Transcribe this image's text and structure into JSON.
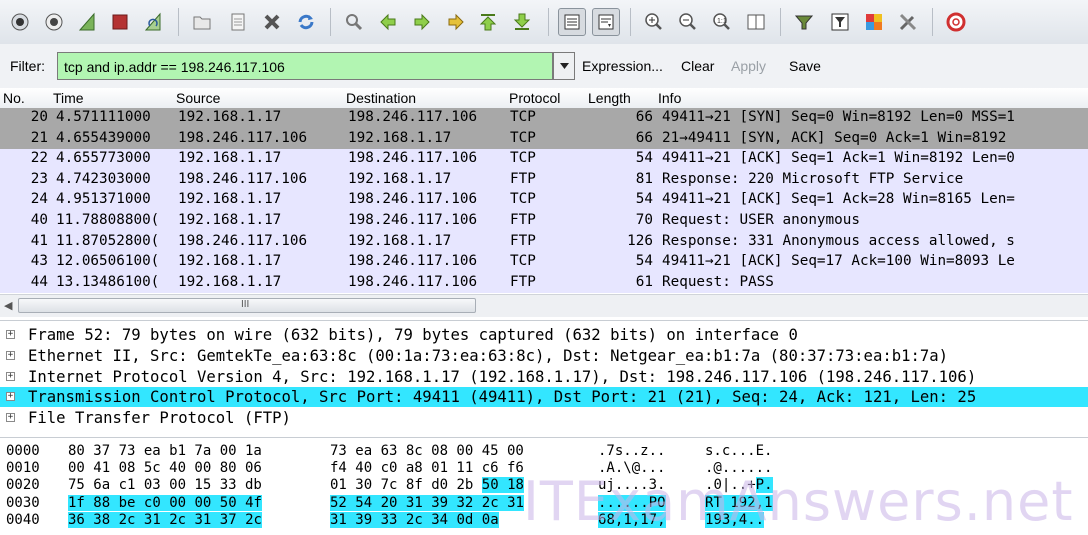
{
  "filter": {
    "label": "Filter:",
    "value": "tcp and ip.addr == 198.246.117.106",
    "actions": [
      "Expression...",
      "Clear",
      "Apply",
      "Save"
    ]
  },
  "columns": [
    "No.",
    "Time",
    "Source",
    "Destination",
    "Protocol",
    "Length",
    "Info"
  ],
  "packets": [
    {
      "no": "20",
      "time": "4.571111000",
      "src": "192.168.1.17",
      "dst": "198.246.117.106",
      "proto": "TCP",
      "len": "66",
      "info": "49411→21 [SYN] Seq=0 Win=8192 Len=0 MSS=1",
      "bg": "#a8a8a8"
    },
    {
      "no": "21",
      "time": "4.655439000",
      "src": "198.246.117.106",
      "dst": "192.168.1.17",
      "proto": "TCP",
      "len": "66",
      "info": "21→49411 [SYN, ACK] Seq=0 Ack=1 Win=8192",
      "bg": "#a8a8a8"
    },
    {
      "no": "22",
      "time": "4.655773000",
      "src": "192.168.1.17",
      "dst": "198.246.117.106",
      "proto": "TCP",
      "len": "54",
      "info": "49411→21 [ACK] Seq=1 Ack=1 Win=8192 Len=0",
      "bg": "#e7e6ff"
    },
    {
      "no": "23",
      "time": "4.742303000",
      "src": "198.246.117.106",
      "dst": "192.168.1.17",
      "proto": "FTP",
      "len": "81",
      "info": "Response: 220 Microsoft FTP Service",
      "bg": "#e7e6ff"
    },
    {
      "no": "24",
      "time": "4.951371000",
      "src": "192.168.1.17",
      "dst": "198.246.117.106",
      "proto": "TCP",
      "len": "54",
      "info": "49411→21 [ACK] Seq=1 Ack=28 Win=8165 Len=",
      "bg": "#e7e6ff"
    },
    {
      "no": "40",
      "time": "11.78808800(",
      "src": "192.168.1.17",
      "dst": "198.246.117.106",
      "proto": "FTP",
      "len": "70",
      "info": "Request: USER anonymous",
      "bg": "#e7e6ff"
    },
    {
      "no": "41",
      "time": "11.87052800(",
      "src": "198.246.117.106",
      "dst": "192.168.1.17",
      "proto": "FTP",
      "len": "126",
      "info": "Response: 331 Anonymous access allowed, s",
      "bg": "#e7e6ff"
    },
    {
      "no": "43",
      "time": "12.06506100(",
      "src": "192.168.1.17",
      "dst": "198.246.117.106",
      "proto": "TCP",
      "len": "54",
      "info": "49411→21 [ACK] Seq=17 Ack=100 Win=8093 Le",
      "bg": "#e7e6ff"
    },
    {
      "no": "44",
      "time": "13.13486100(",
      "src": "192.168.1.17",
      "dst": "198.246.117.106",
      "proto": "FTP",
      "len": "61",
      "info": "Request: PASS",
      "bg": "#e7e6ff"
    }
  ],
  "scroll_grip": "III",
  "details": [
    {
      "text": "Frame 52: 79 bytes on wire (632 bits), 79 bytes captured (632 bits) on interface 0",
      "bg": "#ffffff"
    },
    {
      "text": "Ethernet II, Src: GemtekTe_ea:63:8c (00:1a:73:ea:63:8c), Dst: Netgear_ea:b1:7a (80:37:73:ea:b1:7a)",
      "bg": "#ffffff"
    },
    {
      "text": "Internet Protocol Version 4, Src: 192.168.1.17 (192.168.1.17), Dst: 198.246.117.106 (198.246.117.106)",
      "bg": "#ffffff"
    },
    {
      "text": "Transmission Control Protocol, Src Port: 49411 (49411), Dst Port: 21 (21), Seq: 24, Ack: 121, Len: 25",
      "bg": "#33e6ff"
    },
    {
      "text": "File Transfer Protocol (FTP)",
      "bg": "#ffffff"
    }
  ],
  "hex": [
    {
      "off": "0000",
      "b1": "80 37 73 ea b1 7a 00 1a",
      "b2": "73 ea 63 8c 08 00 45 00",
      "a1": ".7s..z..",
      "a2": "s.c...E."
    },
    {
      "off": "0010",
      "b1": "00 41 08 5c 40 00 80 06",
      "b2": "f4 40 c0 a8 01 11 c6 f6",
      "a1": ".A.\\@...",
      "a2": ".@......"
    },
    {
      "off": "0020",
      "b1": "75 6a c1 03 00 15 33 db",
      "b2": "01 30 7c 8f d0 2b 50 18",
      "a1": "uj....3.",
      "a2": ".0|..+P."
    },
    {
      "off": "0030",
      "b1": "1f 88 be c0 00 00 50 4f",
      "b2": "52 54 20 31 39 32 2c 31",
      "a1": "......PO",
      "a2": "RT 192,1"
    },
    {
      "off": "0040",
      "b1": "36 38 2c 31 2c 31 37 2c",
      "b2": "31 39 33 2c 34 0d 0a",
      "a1": "68,1,17,",
      "a2": "193,4.."
    }
  ],
  "watermark": "ITExamAnswers.net",
  "colors": {
    "filter_valid": "#b2f5b2",
    "selected_field": "#33e6ff",
    "tcp_row": "#e7e6ff",
    "syn_row": "#a8a8a8"
  }
}
